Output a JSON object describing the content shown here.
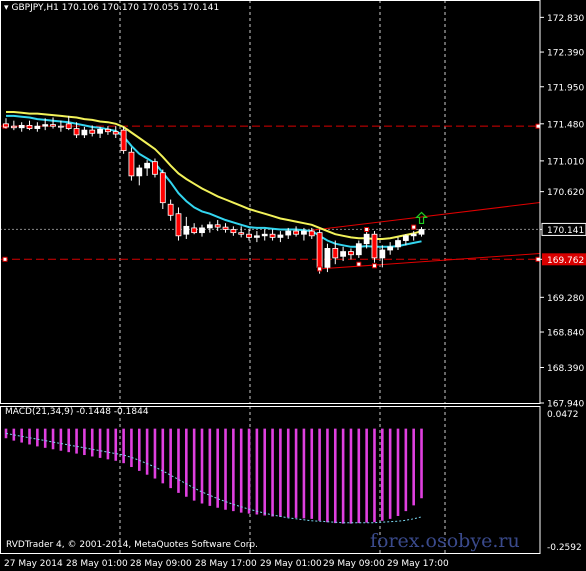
{
  "header": {
    "symbol_text": "GBPJPY,H1",
    "ohlc_text": "170.106 170.170 170.055 170.141"
  },
  "macd_header": "MACD(21,34,9) -0.1448 -0.1844",
  "copyright": "RVDTrader 4, © 2001-2014, MetaQuotes Software Corp.",
  "watermark": "forex.osobye.ru",
  "colors": {
    "background": "#000000",
    "bull_candle": "#ffffff",
    "bear_candle": "#ff0000",
    "ma_fast": "#33d6f0",
    "ma_slow": "#f2f25a",
    "hline": "#d80000",
    "channel": "#e00000",
    "macd_hist": "#e040e0",
    "macd_signal": "#7ad7f0",
    "grid": "#ffffff",
    "up_arrow": "#22cc22"
  },
  "chart_data": [
    {
      "type": "candlestick",
      "symbol": "GBPJPY",
      "timeframe": "H1",
      "y_ticks": [
        "172.830",
        "172.390",
        "171.950",
        "171.480",
        "171.010",
        "170.620",
        "170.141",
        "169.762",
        "169.280",
        "168.840",
        "168.390",
        "167.940"
      ],
      "ylim": [
        167.94,
        173.05
      ],
      "x_ticks": [
        "27 May 2014",
        "28 May 01:00",
        "28 May 09:00",
        "28 May 17:00",
        "29 May 01:00",
        "29 May 09:00",
        "29 May 17:00"
      ],
      "price_labels": {
        "current": "170.141",
        "upper_line": "171.450",
        "lower_line": "169.762"
      },
      "grid": true,
      "candles": [
        {
          "o": 171.48,
          "h": 171.55,
          "l": 171.42,
          "c": 171.44
        },
        {
          "o": 171.45,
          "h": 171.52,
          "l": 171.4,
          "c": 171.43
        },
        {
          "o": 171.43,
          "h": 171.5,
          "l": 171.38,
          "c": 171.46
        },
        {
          "o": 171.46,
          "h": 171.52,
          "l": 171.4,
          "c": 171.42
        },
        {
          "o": 171.42,
          "h": 171.5,
          "l": 171.38,
          "c": 171.45
        },
        {
          "o": 171.45,
          "h": 171.55,
          "l": 171.4,
          "c": 171.47
        },
        {
          "o": 171.47,
          "h": 171.56,
          "l": 171.42,
          "c": 171.45
        },
        {
          "o": 171.45,
          "h": 171.52,
          "l": 171.38,
          "c": 171.44
        },
        {
          "o": 171.48,
          "h": 171.58,
          "l": 171.4,
          "c": 171.42
        },
        {
          "o": 171.42,
          "h": 171.5,
          "l": 171.3,
          "c": 171.34
        },
        {
          "o": 171.34,
          "h": 171.44,
          "l": 171.3,
          "c": 171.4
        },
        {
          "o": 171.4,
          "h": 171.46,
          "l": 171.32,
          "c": 171.36
        },
        {
          "o": 171.36,
          "h": 171.44,
          "l": 171.3,
          "c": 171.41
        },
        {
          "o": 171.41,
          "h": 171.45,
          "l": 171.34,
          "c": 171.38
        },
        {
          "o": 171.38,
          "h": 171.45,
          "l": 171.3,
          "c": 171.35
        },
        {
          "o": 171.4,
          "h": 171.44,
          "l": 171.1,
          "c": 171.14
        },
        {
          "o": 171.12,
          "h": 171.18,
          "l": 170.76,
          "c": 170.82
        },
        {
          "o": 170.82,
          "h": 170.96,
          "l": 170.7,
          "c": 170.92
        },
        {
          "o": 170.92,
          "h": 171.02,
          "l": 170.82,
          "c": 170.98
        },
        {
          "o": 171.0,
          "h": 171.04,
          "l": 170.8,
          "c": 170.84
        },
        {
          "o": 170.86,
          "h": 170.9,
          "l": 170.4,
          "c": 170.48
        },
        {
          "o": 170.46,
          "h": 170.52,
          "l": 170.25,
          "c": 170.32
        },
        {
          "o": 170.34,
          "h": 170.42,
          "l": 170.0,
          "c": 170.06
        },
        {
          "o": 170.08,
          "h": 170.3,
          "l": 170.02,
          "c": 170.18
        },
        {
          "o": 170.16,
          "h": 170.22,
          "l": 170.08,
          "c": 170.1
        },
        {
          "o": 170.1,
          "h": 170.2,
          "l": 170.05,
          "c": 170.16
        },
        {
          "o": 170.16,
          "h": 170.24,
          "l": 170.1,
          "c": 170.2
        },
        {
          "o": 170.2,
          "h": 170.26,
          "l": 170.12,
          "c": 170.17
        },
        {
          "o": 170.17,
          "h": 170.22,
          "l": 170.1,
          "c": 170.14
        },
        {
          "o": 170.14,
          "h": 170.18,
          "l": 170.06,
          "c": 170.1
        },
        {
          "o": 170.1,
          "h": 170.18,
          "l": 170.04,
          "c": 170.08
        },
        {
          "o": 170.08,
          "h": 170.14,
          "l": 170.0,
          "c": 170.04
        },
        {
          "o": 170.04,
          "h": 170.12,
          "l": 169.98,
          "c": 170.06
        },
        {
          "o": 170.06,
          "h": 170.14,
          "l": 170.0,
          "c": 170.08
        },
        {
          "o": 170.08,
          "h": 170.14,
          "l": 170.0,
          "c": 170.04
        },
        {
          "o": 170.04,
          "h": 170.12,
          "l": 169.98,
          "c": 170.07
        },
        {
          "o": 170.07,
          "h": 170.16,
          "l": 170.02,
          "c": 170.12
        },
        {
          "o": 170.12,
          "h": 170.18,
          "l": 170.05,
          "c": 170.08
        },
        {
          "o": 170.08,
          "h": 170.16,
          "l": 170.0,
          "c": 170.12
        },
        {
          "o": 170.12,
          "h": 170.16,
          "l": 170.02,
          "c": 170.06
        },
        {
          "o": 170.1,
          "h": 170.14,
          "l": 169.58,
          "c": 169.66
        },
        {
          "o": 169.66,
          "h": 169.96,
          "l": 169.6,
          "c": 169.9
        },
        {
          "o": 169.9,
          "h": 170.0,
          "l": 169.7,
          "c": 169.78
        },
        {
          "o": 169.8,
          "h": 169.92,
          "l": 169.74,
          "c": 169.86
        },
        {
          "o": 169.86,
          "h": 169.9,
          "l": 169.76,
          "c": 169.82
        },
        {
          "o": 169.82,
          "h": 170.0,
          "l": 169.78,
          "c": 169.96
        },
        {
          "o": 169.96,
          "h": 170.14,
          "l": 169.9,
          "c": 170.08
        },
        {
          "o": 170.08,
          "h": 170.12,
          "l": 169.72,
          "c": 169.78
        },
        {
          "o": 169.78,
          "h": 169.94,
          "l": 169.66,
          "c": 169.88
        },
        {
          "o": 169.88,
          "h": 169.98,
          "l": 169.82,
          "c": 169.92
        },
        {
          "o": 169.92,
          "h": 170.04,
          "l": 169.88,
          "c": 170.0
        },
        {
          "o": 170.0,
          "h": 170.08,
          "l": 169.94,
          "c": 170.06
        },
        {
          "o": 170.06,
          "h": 170.12,
          "l": 170.0,
          "c": 170.08
        },
        {
          "o": 170.08,
          "h": 170.17,
          "l": 170.05,
          "c": 170.14
        }
      ],
      "ma_fast": [
        171.58,
        171.58,
        171.57,
        171.56,
        171.54,
        171.53,
        171.52,
        171.51,
        171.5,
        171.48,
        171.46,
        171.44,
        171.43,
        171.41,
        171.39,
        171.32,
        171.2,
        171.1,
        171.04,
        170.98,
        170.86,
        170.74,
        170.6,
        170.5,
        170.42,
        170.37,
        170.34,
        170.3,
        170.26,
        170.23,
        170.2,
        170.17,
        170.16,
        170.16,
        170.15,
        170.14,
        170.14,
        170.14,
        170.13,
        170.12,
        170.06,
        170.0,
        169.96,
        169.94,
        169.92,
        169.92,
        169.93,
        169.92,
        169.92,
        169.92,
        169.93,
        169.95,
        169.97,
        169.99
      ],
      "ma_slow": [
        171.63,
        171.63,
        171.62,
        171.61,
        171.61,
        171.6,
        171.59,
        171.58,
        171.57,
        171.56,
        171.54,
        171.53,
        171.51,
        171.5,
        171.48,
        171.44,
        171.37,
        171.3,
        171.23,
        171.16,
        171.06,
        170.95,
        170.85,
        170.78,
        170.72,
        170.66,
        170.61,
        170.56,
        170.52,
        170.48,
        170.44,
        170.4,
        170.37,
        170.34,
        170.31,
        170.28,
        170.26,
        170.24,
        170.22,
        170.2,
        170.16,
        170.12,
        170.08,
        170.06,
        170.04,
        170.03,
        170.03,
        170.02,
        170.02,
        170.03,
        170.05,
        170.07,
        170.09,
        170.12
      ],
      "horizontal_lines": [
        171.45,
        169.762
      ],
      "channel_upper": [
        {
          "i": 39,
          "p": 170.13
        },
        {
          "i": 63,
          "p": 170.42
        }
      ],
      "channel_lower": [
        {
          "i": 40,
          "p": 169.64
        },
        {
          "i": 63,
          "p": 169.8
        }
      ],
      "fractal_markers": [
        {
          "i": 40,
          "p": 169.64
        },
        {
          "i": 45,
          "p": 169.7
        },
        {
          "i": 47,
          "p": 169.68
        },
        {
          "i": 46,
          "p": 170.14
        },
        {
          "i": 52,
          "p": 170.17
        }
      ],
      "signal_arrow": {
        "i": 53,
        "p": 170.28,
        "direction": "up"
      }
    },
    {
      "type": "bar",
      "name": "MACD(21,34,9)",
      "y_ticks": [
        "0.0472",
        "-0.2592"
      ],
      "ylim": [
        -0.2592,
        0.0472
      ],
      "histogram": [
        -0.02,
        -0.025,
        -0.029,
        -0.033,
        -0.037,
        -0.04,
        -0.043,
        -0.046,
        -0.049,
        -0.052,
        -0.055,
        -0.058,
        -0.061,
        -0.064,
        -0.067,
        -0.072,
        -0.08,
        -0.088,
        -0.096,
        -0.104,
        -0.114,
        -0.124,
        -0.134,
        -0.142,
        -0.15,
        -0.156,
        -0.161,
        -0.165,
        -0.169,
        -0.172,
        -0.175,
        -0.177,
        -0.179,
        -0.181,
        -0.183,
        -0.184,
        -0.185,
        -0.186,
        -0.187,
        -0.188,
        -0.192,
        -0.195,
        -0.197,
        -0.198,
        -0.198,
        -0.197,
        -0.196,
        -0.195,
        -0.192,
        -0.188,
        -0.182,
        -0.172,
        -0.16,
        -0.145
      ],
      "signal": [
        -0.01,
        -0.013,
        -0.016,
        -0.019,
        -0.022,
        -0.025,
        -0.028,
        -0.031,
        -0.034,
        -0.037,
        -0.04,
        -0.043,
        -0.046,
        -0.049,
        -0.052,
        -0.055,
        -0.06,
        -0.066,
        -0.073,
        -0.08,
        -0.088,
        -0.097,
        -0.106,
        -0.115,
        -0.124,
        -0.132,
        -0.139,
        -0.146,
        -0.152,
        -0.158,
        -0.163,
        -0.168,
        -0.172,
        -0.176,
        -0.18,
        -0.183,
        -0.186,
        -0.188,
        -0.19,
        -0.192,
        -0.193,
        -0.194,
        -0.195,
        -0.196,
        -0.196,
        -0.196,
        -0.196,
        -0.196,
        -0.195,
        -0.194,
        -0.193,
        -0.191,
        -0.188,
        -0.184
      ]
    }
  ]
}
